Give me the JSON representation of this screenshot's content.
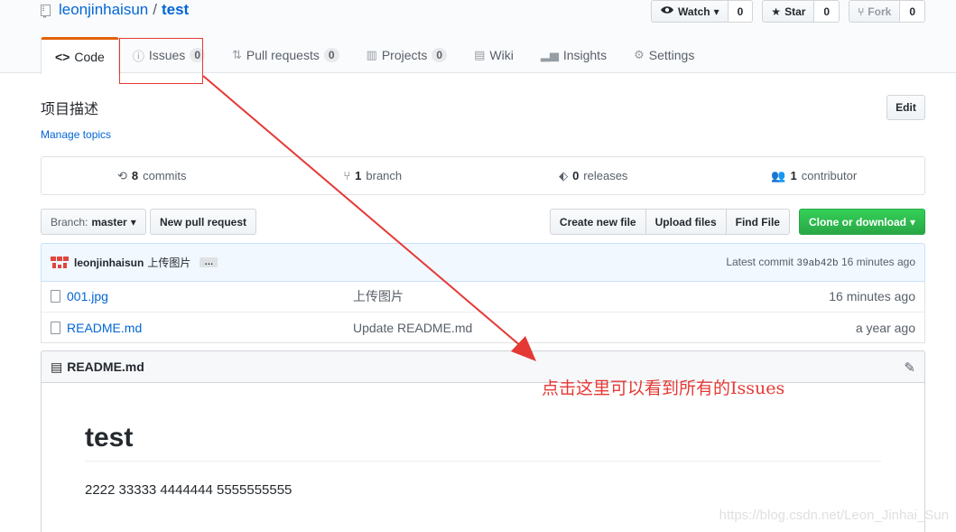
{
  "repo": {
    "owner": "leonjinhaisun",
    "separator": "/",
    "name": "test"
  },
  "actions": {
    "watch_label": "Watch",
    "watch_count": "0",
    "star_label": "Star",
    "star_count": "0",
    "fork_label": "Fork",
    "fork_count": "0"
  },
  "tabs": [
    {
      "label": "Code"
    },
    {
      "label": "Issues",
      "count": "0"
    },
    {
      "label": "Pull requests",
      "count": "0"
    },
    {
      "label": "Projects",
      "count": "0"
    },
    {
      "label": "Wiki"
    },
    {
      "label": "Insights"
    },
    {
      "label": "Settings"
    }
  ],
  "description": "项目描述",
  "edit_label": "Edit",
  "manage_topics": "Manage topics",
  "summary": {
    "commits_num": "8",
    "commits_label": "commits",
    "branch_num": "1",
    "branch_label": "branch",
    "releases_num": "0",
    "releases_label": "releases",
    "contributor_num": "1",
    "contributor_label": "contributor"
  },
  "filebar": {
    "branch_prefix": "Branch:",
    "branch_name": "master",
    "new_pr": "New pull request",
    "create_file": "Create new file",
    "upload_files": "Upload files",
    "find_file": "Find File",
    "clone": "Clone or download"
  },
  "commit": {
    "author": "leonjinhaisun",
    "message": "上传图片",
    "ellipsis": "…",
    "latest_prefix": "Latest commit",
    "sha": "39ab42b",
    "age": "16 minutes ago"
  },
  "files": [
    {
      "name": "001.jpg",
      "message": "上传图片",
      "age": "16 minutes ago"
    },
    {
      "name": "README.md",
      "message": "Update README.md",
      "age": "a year ago"
    }
  ],
  "readme": {
    "title": "README.md",
    "h1": "test",
    "paragraph": "2222 33333 4444444 5555555555"
  },
  "annotation": "点击这里可以看到所有的Issues",
  "watermark": "https://blog.csdn.net/Leon_Jinhai_Sun",
  "colors": {
    "accent": "#0366d6",
    "annotation": "#e53935",
    "clone": "#28a745",
    "tab_top": "#e36209"
  }
}
